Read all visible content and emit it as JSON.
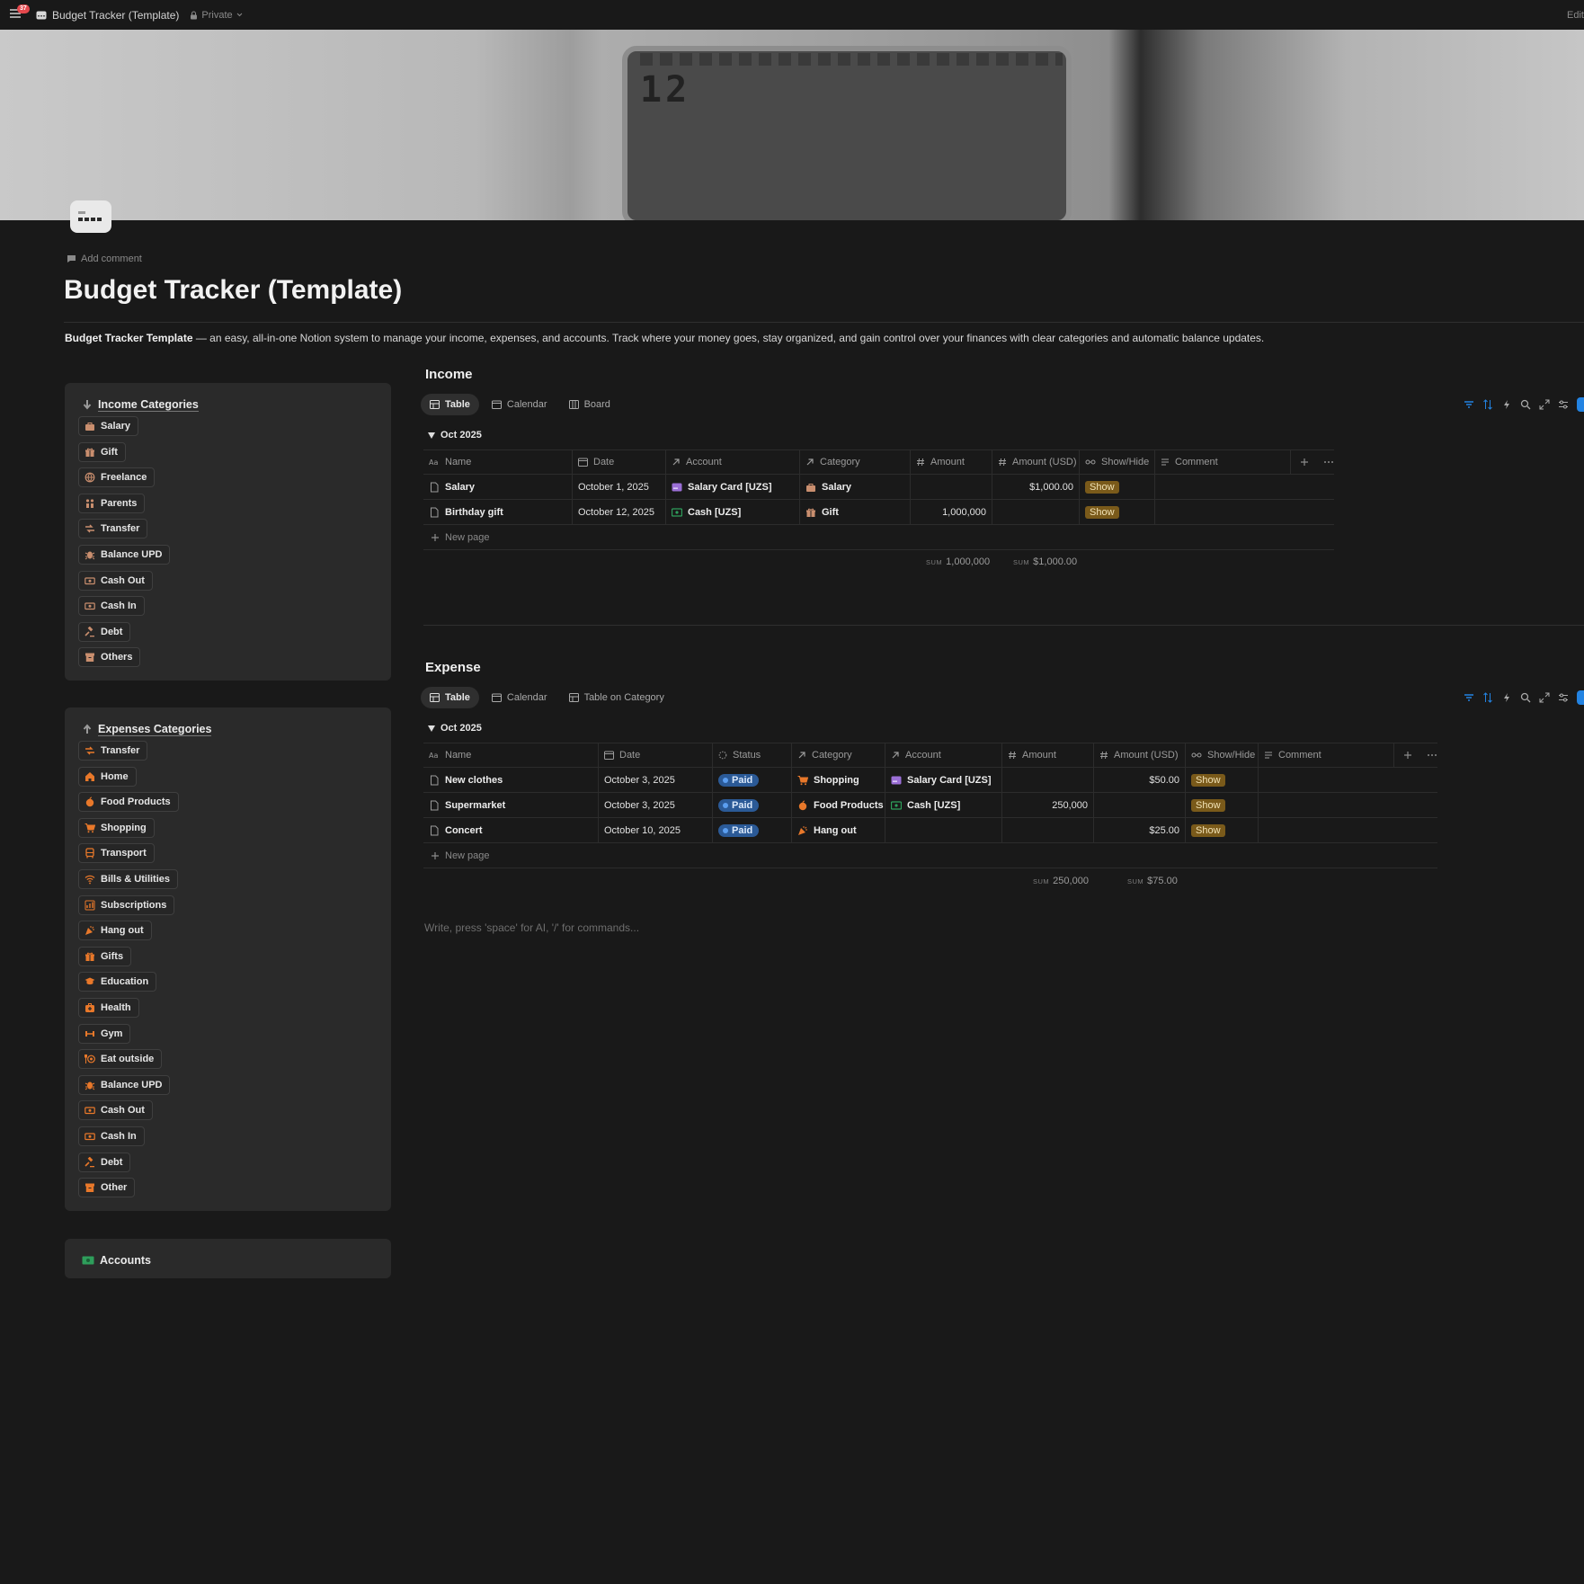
{
  "topbar": {
    "notifications": "37",
    "page_name": "Budget Tracker (Template)",
    "privacy": "Private",
    "edit": "Edit"
  },
  "page": {
    "add_comment": "Add comment",
    "title": "Budget Tracker (Template)",
    "desc_bold": "Budget Tracker Template",
    "desc_rest": " — an easy, all-in-one Notion system to manage your income, expenses, and accounts. Track where your money goes, stay organized, and gain control over your finances with clear categories and automatic balance updates.",
    "write_hint": "Write, press 'space' for AI, '/' for commands..."
  },
  "income_categories": {
    "title": "Income Categories",
    "items": [
      "Salary",
      "Gift",
      "Freelance",
      "Parents",
      "Transfer",
      "Balance UPD",
      "Cash Out",
      "Cash In",
      "Debt",
      "Others"
    ]
  },
  "expense_categories": {
    "title": "Expenses Categories",
    "items": [
      "Transfer",
      "Home",
      "Food Products",
      "Shopping",
      "Transport",
      "Bills & Utilities",
      "Subscriptions",
      "Hang out",
      "Gifts",
      "Education",
      "Health",
      "Gym",
      "Eat outside",
      "Balance UPD",
      "Cash Out",
      "Cash In",
      "Debt",
      "Other"
    ]
  },
  "accounts": {
    "title": "Accounts"
  },
  "income": {
    "title": "Income",
    "tabs": [
      "Table",
      "Calendar",
      "Board"
    ],
    "group": "Oct 2025",
    "columns": [
      "Name",
      "Date",
      "Account",
      "Category",
      "Amount",
      "Amount (USD)",
      "Show/Hide",
      "Comment"
    ],
    "rows": [
      {
        "name": "Salary",
        "date": "October 1, 2025",
        "account": "Salary Card [UZS]",
        "category": "Salary",
        "amount": "",
        "amount_usd": "$1,000.00",
        "show": "Show",
        "comment": ""
      },
      {
        "name": "Birthday gift",
        "date": "October 12, 2025",
        "account": "Cash [UZS]",
        "category": "Gift",
        "amount": "1,000,000",
        "amount_usd": "",
        "show": "Show",
        "comment": ""
      }
    ],
    "new_page": "New page",
    "sum_label": "SUM",
    "sum_amount": "1,000,000",
    "sum_usd": "$1,000.00"
  },
  "expense": {
    "title": "Expense",
    "tabs": [
      "Table",
      "Calendar",
      "Table on Category"
    ],
    "group": "Oct 2025",
    "columns": [
      "Name",
      "Date",
      "Status",
      "Category",
      "Account",
      "Amount",
      "Amount (USD)",
      "Show/Hide",
      "Comment"
    ],
    "rows": [
      {
        "name": "New clothes",
        "date": "October 3, 2025",
        "status": "Paid",
        "category": "Shopping",
        "account": "Salary Card [UZS]",
        "amount": "",
        "amount_usd": "$50.00",
        "show": "Show",
        "comment": ""
      },
      {
        "name": "Supermarket",
        "date": "October 3, 2025",
        "status": "Paid",
        "category": "Food Products",
        "account": "Cash [UZS]",
        "amount": "250,000",
        "amount_usd": "",
        "show": "Show",
        "comment": ""
      },
      {
        "name": "Concert",
        "date": "October 10, 2025",
        "status": "Paid",
        "category": "Hang out",
        "account": "",
        "amount": "",
        "amount_usd": "$25.00",
        "show": "Show",
        "comment": ""
      }
    ],
    "new_page": "New page",
    "sum_label": "SUM",
    "sum_amount": "250,000",
    "sum_usd": "$75.00"
  },
  "colors": {
    "background": "#191919",
    "card": "#2a2a2a",
    "accent_orange": "#e8782a",
    "income_icon": "#c98e6e",
    "status_blue": "#2b5a97",
    "show_tag": "#7a5a1a",
    "accent_blue": "#2383e2"
  }
}
